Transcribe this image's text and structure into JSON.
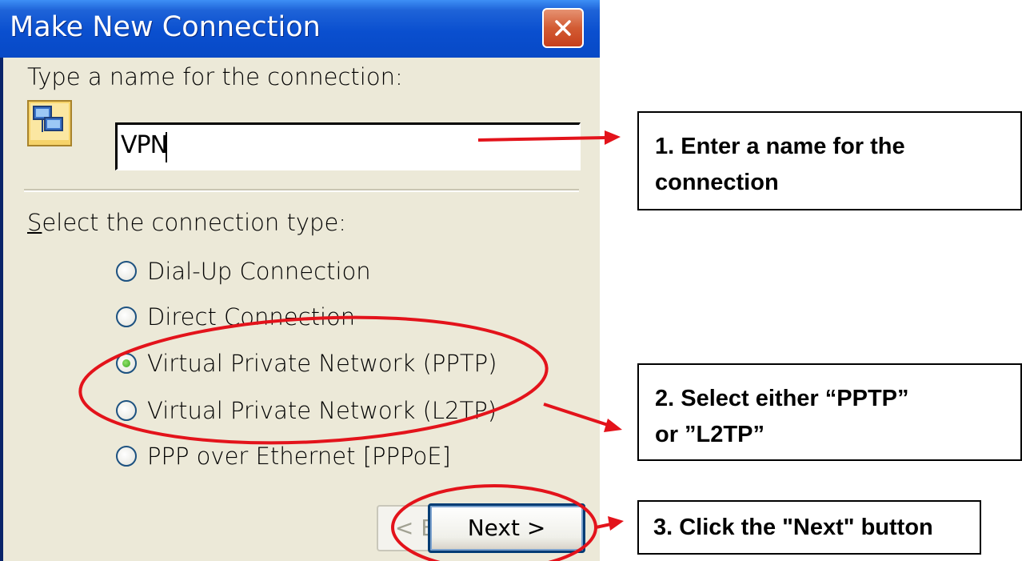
{
  "window": {
    "title": "Make New Connection"
  },
  "form": {
    "name_label": "Type a name for the connection:",
    "name_value": "VPN",
    "type_label": "Select the connection type:"
  },
  "connection_types": [
    {
      "label": "Dial-Up Connection",
      "selected": false
    },
    {
      "label": "Direct Connection",
      "selected": false
    },
    {
      "label": "Virtual Private Network (PPTP)",
      "selected": true
    },
    {
      "label": "Virtual Private Network (L2TP)",
      "selected": false
    },
    {
      "label": "PPP over Ethernet [PPPoE]",
      "selected": false
    }
  ],
  "buttons": {
    "back": "< Back",
    "next": "Next >"
  },
  "annotations": {
    "step1": [
      "1. Enter a name for the",
      "connection"
    ],
    "step2": [
      "2. Select either “PPTP”",
      "or ”L2TP”"
    ],
    "step3": [
      "3. Click the \"Next\" button"
    ]
  },
  "colors": {
    "titlebar": "#0a4fcf",
    "dialog_bg": "#ece9d8",
    "annotation_red": "#e3131b",
    "radio_selected": "#3aa420"
  },
  "icons": [
    "close-icon",
    "network-connection-icon",
    "radio-icon"
  ]
}
